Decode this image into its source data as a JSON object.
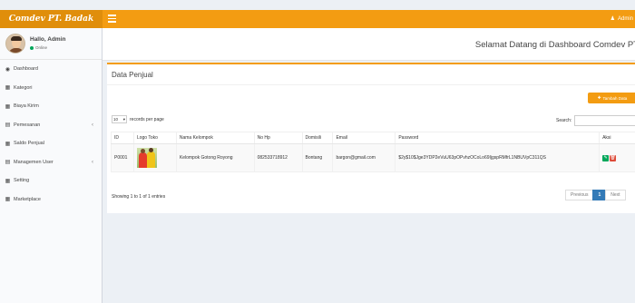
{
  "brand": "Comdev PT. Badak",
  "topbar": {
    "user_label": "Admin"
  },
  "user": {
    "greeting": "Hallo, Admin",
    "status": "Online"
  },
  "sidebar": {
    "items": [
      {
        "label": "Dashboard",
        "icon": "dashboard-icon"
      },
      {
        "label": "Kategori",
        "icon": "grid-icon"
      },
      {
        "label": "Biaya Kirim",
        "icon": "grid-icon"
      },
      {
        "label": "Pemesanan",
        "icon": "table-icon",
        "expandable": true
      },
      {
        "label": "Saldo Penjual",
        "icon": "grid-icon"
      },
      {
        "label": "Managemen User",
        "icon": "table-icon",
        "expandable": true
      },
      {
        "label": "Setting",
        "icon": "grid-icon"
      },
      {
        "label": "Marketplace",
        "icon": "grid-icon"
      }
    ]
  },
  "header": {
    "welcome": "Selamat Datang di Dashboard Comdev PT"
  },
  "box": {
    "title": "Data Penjual",
    "add_button": "Tambah Data",
    "length_value": "10",
    "length_label": "records per page",
    "search_label": "Search:",
    "search_value": ""
  },
  "table": {
    "columns": [
      "ID",
      "Logo Toko",
      "Nama Kelompok",
      "No Hp",
      "Domisili",
      "Email",
      "Password",
      "Aksi"
    ],
    "rows": [
      {
        "id": "P0001",
        "nama": "Kelompok Gotong Royong",
        "hp": "082533718912",
        "domisili": "Bontang",
        "email": "bargon@gmail.com",
        "password": "$2y$10$Jge3YDP2eVuU63pOPvhzOCoLo69IjgspRMfrL1NBUVpC311QS"
      }
    ]
  },
  "footer": {
    "info": "Showing 1 to 1 of 1 entries",
    "prev": "Previous",
    "page": "1",
    "next": "Next"
  },
  "colors": {
    "accent": "#f39c12",
    "edit": "#00a65a",
    "delete": "#dd4b39",
    "page_active": "#337ab7"
  }
}
